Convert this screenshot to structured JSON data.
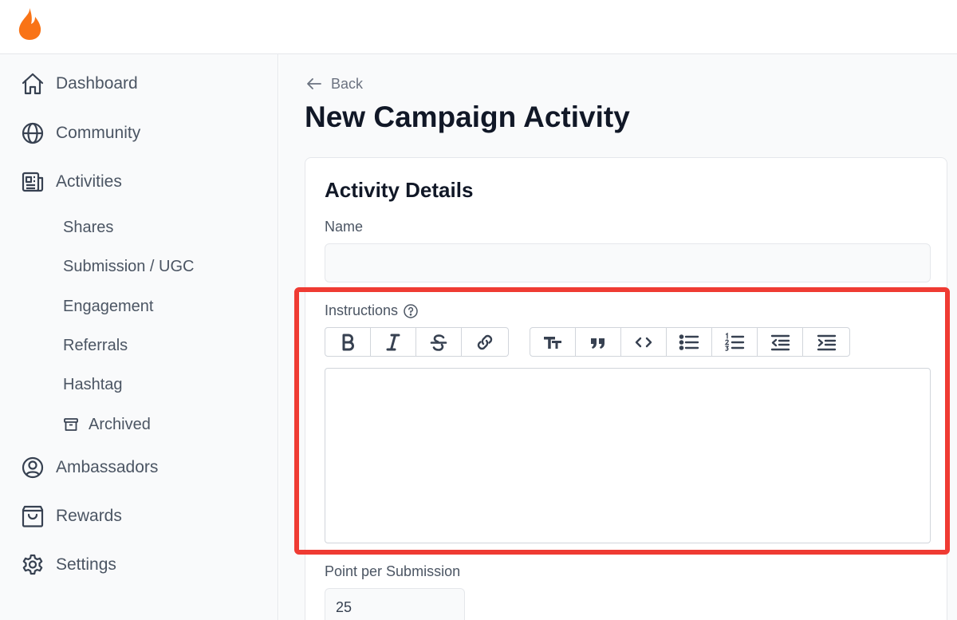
{
  "brand": {
    "accent": "#f97316",
    "highlight": "#ef3b33"
  },
  "sidebar": {
    "items": [
      {
        "label": "Dashboard",
        "icon": "home-icon"
      },
      {
        "label": "Community",
        "icon": "globe-icon"
      },
      {
        "label": "Activities",
        "icon": "newspaper-icon"
      }
    ],
    "sub_items": [
      {
        "label": "Shares"
      },
      {
        "label": "Submission / UGC"
      },
      {
        "label": "Engagement"
      },
      {
        "label": "Referrals"
      },
      {
        "label": "Hashtag"
      },
      {
        "label": "Archived",
        "icon": "archive-icon"
      }
    ],
    "items_after": [
      {
        "label": "Ambassadors",
        "icon": "user-circle-icon"
      },
      {
        "label": "Rewards",
        "icon": "shopping-bag-icon"
      },
      {
        "label": "Settings",
        "icon": "gear-icon"
      }
    ]
  },
  "header": {
    "back_label": "Back",
    "title": "New Campaign Activity"
  },
  "form": {
    "section_title": "Activity Details",
    "name_label": "Name",
    "name_value": "",
    "instructions_label": "Instructions",
    "toolbar_group1": [
      "bold-icon",
      "italic-icon",
      "strikethrough-icon",
      "link-icon"
    ],
    "toolbar_group2": [
      "heading-icon",
      "quote-icon",
      "code-icon",
      "bullet-list-icon",
      "numbered-list-icon",
      "outdent-icon",
      "indent-icon"
    ],
    "points_label": "Point per Submission",
    "points_value": "25"
  }
}
